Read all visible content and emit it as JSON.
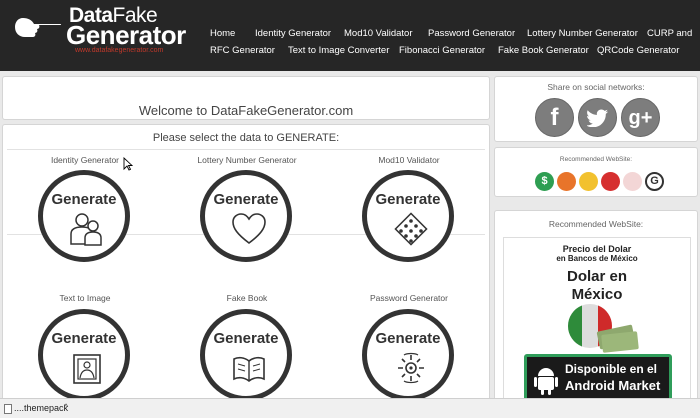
{
  "brand": {
    "line1_a": "Data",
    "line1_b": "Fake",
    "line2": "Generator",
    "url": "www.datafakegenerator.com"
  },
  "nav": [
    "Home",
    "Identity Generator",
    "Mod10 Validator",
    "Password Generator",
    "Lottery Number Generator",
    "CURP and",
    "RFC Generator",
    "Text to Image Converter",
    "Fibonacci Generator",
    "Fake Book Generator",
    "QRCode Generator"
  ],
  "welcome": "Welcome to DataFakeGenerator.com",
  "select_title": "Please select the data to GENERATE:",
  "generators": [
    {
      "label": "Identity Generator",
      "button": "Generate",
      "icon": "people-icon"
    },
    {
      "label": "Lottery Number Generator",
      "button": "Generate",
      "icon": "heart-icon"
    },
    {
      "label": "Mod10 Validator",
      "button": "Generate",
      "icon": "card-icon"
    },
    {
      "label": "Text to Image",
      "button": "Generate",
      "icon": "image-icon"
    },
    {
      "label": "Fake Book",
      "button": "Generate",
      "icon": "book-icon"
    },
    {
      "label": "Password Generator",
      "button": "Generate",
      "icon": "password-icon"
    }
  ],
  "share": {
    "title": "Share on social networks:",
    "facebook": "f",
    "google": "g+"
  },
  "recommended_small": {
    "title": "Recommended WebSite:",
    "icons": [
      "dollar-icon",
      "orange-icon",
      "coin-icon",
      "red-face-icon",
      "feather-icon",
      "g-icon"
    ],
    "glyphs": [
      "$",
      "",
      "",
      "",
      "",
      "G"
    ]
  },
  "recommended_ad": {
    "title": "Recommended WebSite:",
    "ad_line1": "Precio del Dolar",
    "ad_line2": "en Bancos de México",
    "ad_line3": "Dolar en",
    "ad_line4": "México",
    "store_line1": "Disponible en el",
    "store_line2": "Android Market"
  },
  "download": {
    "name": "....themepack",
    "chevron": "^"
  }
}
